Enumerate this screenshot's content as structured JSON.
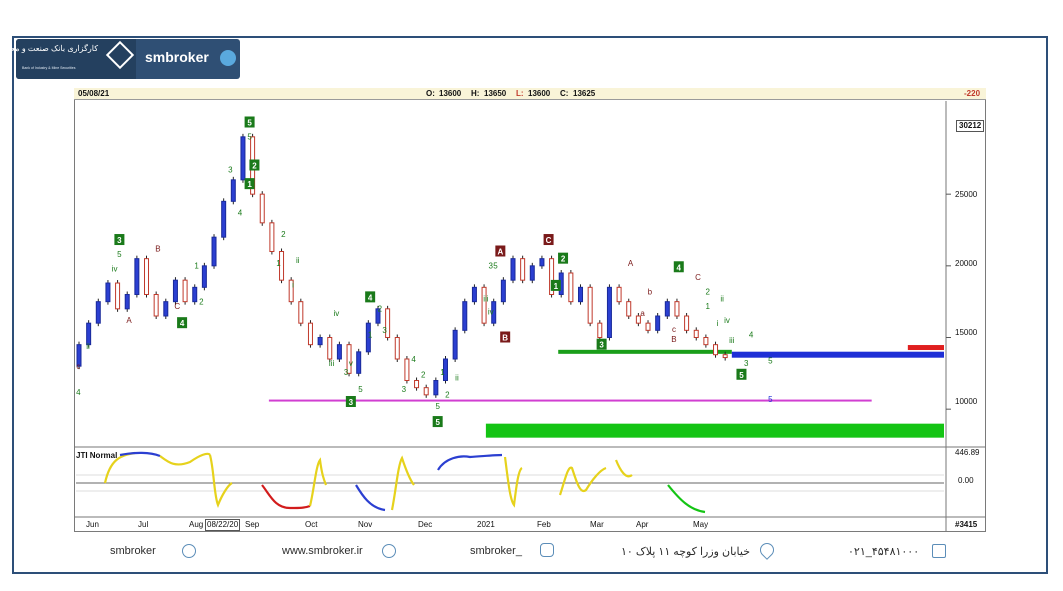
{
  "brand": {
    "logo_text": "کارگزاری بانک صنعت و معدن",
    "logo_subtext": "Bank of Industry & Mine Securities",
    "channel_name": "smbroker",
    "telegram_icon": "telegram-icon"
  },
  "header": {
    "date": "05/08/21",
    "open_label": "O:",
    "open_value": "13600",
    "high_label": "H:",
    "high_value": "13650",
    "low_label": "L:",
    "low_value": "13600",
    "close_label": "C:",
    "close_value": "13625",
    "change_value": "-220",
    "label_color_open": "#111111",
    "label_color_low": "#c0392b",
    "change_color": "#c0392b"
  },
  "chart_data": {
    "type": "line",
    "title": "",
    "price_axis_ticks": [
      "25000",
      "20000",
      "15000",
      "10000"
    ],
    "price_axis_top_label": "30212",
    "ylim": [
      7500,
      31500
    ],
    "month_labels": [
      "Jun",
      "Jul",
      "Aug",
      "Sep",
      "Oct",
      "Nov",
      "Dec",
      "2021",
      "Feb",
      "Mar",
      "Apr",
      "May"
    ],
    "date_cursor_label": "08/22/20",
    "bar_count_label": "#3415",
    "price_path": [
      {
        "x": 0,
        "y": 13000
      },
      {
        "x": 4,
        "y": 14500
      },
      {
        "x": 8,
        "y": 16000
      },
      {
        "x": 12,
        "y": 17500
      },
      {
        "x": 16,
        "y": 18800
      },
      {
        "x": 20,
        "y": 17000
      },
      {
        "x": 24,
        "y": 18000
      },
      {
        "x": 28,
        "y": 20500
      },
      {
        "x": 32,
        "y": 18000
      },
      {
        "x": 36,
        "y": 16500
      },
      {
        "x": 40,
        "y": 17500
      },
      {
        "x": 44,
        "y": 19000
      },
      {
        "x": 48,
        "y": 17500
      },
      {
        "x": 52,
        "y": 18500
      },
      {
        "x": 56,
        "y": 20000
      },
      {
        "x": 60,
        "y": 22000
      },
      {
        "x": 64,
        "y": 24500
      },
      {
        "x": 68,
        "y": 26000
      },
      {
        "x": 72,
        "y": 29000
      },
      {
        "x": 76,
        "y": 25000
      },
      {
        "x": 80,
        "y": 23000
      },
      {
        "x": 84,
        "y": 21000
      },
      {
        "x": 88,
        "y": 19000
      },
      {
        "x": 92,
        "y": 17500
      },
      {
        "x": 96,
        "y": 16000
      },
      {
        "x": 100,
        "y": 14500
      },
      {
        "x": 104,
        "y": 15000
      },
      {
        "x": 108,
        "y": 13500
      },
      {
        "x": 112,
        "y": 14500
      },
      {
        "x": 116,
        "y": 12500
      },
      {
        "x": 120,
        "y": 14000
      },
      {
        "x": 124,
        "y": 16000
      },
      {
        "x": 128,
        "y": 17000
      },
      {
        "x": 132,
        "y": 15000
      },
      {
        "x": 136,
        "y": 13500
      },
      {
        "x": 140,
        "y": 12000
      },
      {
        "x": 144,
        "y": 11500
      },
      {
        "x": 148,
        "y": 11000
      },
      {
        "x": 152,
        "y": 12000
      },
      {
        "x": 156,
        "y": 13500
      },
      {
        "x": 160,
        "y": 15500
      },
      {
        "x": 164,
        "y": 17500
      },
      {
        "x": 168,
        "y": 18500
      },
      {
        "x": 172,
        "y": 16000
      },
      {
        "x": 176,
        "y": 17500
      },
      {
        "x": 180,
        "y": 19000
      },
      {
        "x": 184,
        "y": 20500
      },
      {
        "x": 188,
        "y": 19000
      },
      {
        "x": 192,
        "y": 20000
      },
      {
        "x": 196,
        "y": 20500
      },
      {
        "x": 200,
        "y": 18000
      },
      {
        "x": 204,
        "y": 19500
      },
      {
        "x": 208,
        "y": 17500
      },
      {
        "x": 212,
        "y": 18500
      },
      {
        "x": 216,
        "y": 16000
      },
      {
        "x": 220,
        "y": 15000
      },
      {
        "x": 224,
        "y": 18500
      },
      {
        "x": 228,
        "y": 17500
      },
      {
        "x": 232,
        "y": 16500
      },
      {
        "x": 236,
        "y": 16000
      },
      {
        "x": 240,
        "y": 15500
      },
      {
        "x": 244,
        "y": 16500
      },
      {
        "x": 248,
        "y": 17500
      },
      {
        "x": 252,
        "y": 16500
      },
      {
        "x": 256,
        "y": 15500
      },
      {
        "x": 260,
        "y": 15000
      },
      {
        "x": 264,
        "y": 14500
      },
      {
        "x": 268,
        "y": 13800
      },
      {
        "x": 272,
        "y": 13600
      }
    ],
    "zones": [
      {
        "name": "green-zone",
        "from": 200,
        "to": 272,
        "y": 14000,
        "color": "#1a9e1a"
      },
      {
        "name": "blue-zone",
        "from": 272,
        "to": 360,
        "y": 13800,
        "color": "#1f2fd6"
      },
      {
        "name": "red-zone",
        "from": 345,
        "to": 360,
        "y": 14300,
        "color": "#e01f1f"
      },
      {
        "name": "magenta-line",
        "from": 80,
        "to": 330,
        "y": 10600,
        "color": "#d13fd1"
      },
      {
        "name": "green-band",
        "from": 170,
        "to": 360,
        "y": 8500,
        "color": "#14c414"
      }
    ],
    "wave_labels_boxed": [
      {
        "text": "5",
        "x": 72,
        "y": 30000,
        "color": "#1a7a1a"
      },
      {
        "text": "2",
        "x": 74,
        "y": 27000,
        "color": "#1a7a1a"
      },
      {
        "text": "1",
        "x": 72,
        "y": 25700,
        "color": "#1a7a1a"
      },
      {
        "text": "3",
        "x": 18,
        "y": 21800,
        "color": "#1a7a1a"
      },
      {
        "text": "4",
        "x": 44,
        "y": 16000,
        "color": "#1a7a1a"
      },
      {
        "text": "4",
        "x": 122,
        "y": 17800,
        "color": "#1a7a1a"
      },
      {
        "text": "3",
        "x": 114,
        "y": 10500,
        "color": "#1a7a1a"
      },
      {
        "text": "5",
        "x": 150,
        "y": 9100,
        "color": "#1a7a1a"
      },
      {
        "text": "A",
        "x": 176,
        "y": 21000,
        "color": "#7a1a1a"
      },
      {
        "text": "B",
        "x": 178,
        "y": 15000,
        "color": "#7a1a1a"
      },
      {
        "text": "C",
        "x": 196,
        "y": 21800,
        "color": "#7a1a1a"
      },
      {
        "text": "2",
        "x": 202,
        "y": 20500,
        "color": "#1a7a1a"
      },
      {
        "text": "1",
        "x": 199,
        "y": 18600,
        "color": "#1a7a1a"
      },
      {
        "text": "3",
        "x": 218,
        "y": 14500,
        "color": "#1a7a1a"
      },
      {
        "text": "4",
        "x": 250,
        "y": 19900,
        "color": "#1a7a1a"
      },
      {
        "text": "5",
        "x": 276,
        "y": 12400,
        "color": "#1a7a1a"
      }
    ],
    "wave_labels_plain": [
      {
        "text": "5",
        "x": 72,
        "y": 28800,
        "color": "#1a7a1a"
      },
      {
        "text": "3",
        "x": 64,
        "y": 26500,
        "color": "#1a7a1a"
      },
      {
        "text": "4",
        "x": 68,
        "y": 23500,
        "color": "#1a7a1a"
      },
      {
        "text": "5",
        "x": 18,
        "y": 20600,
        "color": "#1a7a1a"
      },
      {
        "text": "B",
        "x": 34,
        "y": 21000,
        "color": "#7a1a1a"
      },
      {
        "text": "iv",
        "x": 16,
        "y": 19600,
        "color": "#1a7a1a"
      },
      {
        "text": "A",
        "x": 22,
        "y": 16000,
        "color": "#7a1a1a"
      },
      {
        "text": "C",
        "x": 42,
        "y": 17000,
        "color": "#7a1a1a"
      },
      {
        "text": "2",
        "x": 52,
        "y": 17300,
        "color": "#1a7a1a"
      },
      {
        "text": "1",
        "x": 50,
        "y": 19800,
        "color": "#1a7a1a"
      },
      {
        "text": "4",
        "x": 1,
        "y": 11000,
        "color": "#1a7a1a"
      },
      {
        "text": "c",
        "x": 1,
        "y": 12800,
        "color": "#7a1a1a"
      },
      {
        "text": "ii",
        "x": 5,
        "y": 14200,
        "color": "#1a7a1a"
      },
      {
        "text": "ii",
        "x": 92,
        "y": 20200,
        "color": "#1a7a1a"
      },
      {
        "text": "2",
        "x": 86,
        "y": 22000,
        "color": "#1a7a1a"
      },
      {
        "text": "1",
        "x": 84,
        "y": 20000,
        "color": "#1a7a1a"
      },
      {
        "text": "i",
        "x": 90,
        "y": 18500,
        "color": "#1a7a1a"
      },
      {
        "text": "iv",
        "x": 108,
        "y": 16500,
        "color": "#1a7a1a"
      },
      {
        "text": "iii",
        "x": 106,
        "y": 13000,
        "color": "#1a7a1a"
      },
      {
        "text": "v",
        "x": 114,
        "y": 13000,
        "color": "#1a7a1a"
      },
      {
        "text": "3",
        "x": 112,
        "y": 12400,
        "color": "#1a7a1a"
      },
      {
        "text": "5",
        "x": 118,
        "y": 11200,
        "color": "#1a7a1a"
      },
      {
        "text": "2",
        "x": 126,
        "y": 16800,
        "color": "#1a7a1a"
      },
      {
        "text": "1",
        "x": 122,
        "y": 15000,
        "color": "#1a7a1a"
      },
      {
        "text": "3",
        "x": 128,
        "y": 15300,
        "color": "#1a7a1a"
      },
      {
        "text": "4",
        "x": 140,
        "y": 13300,
        "color": "#1a7a1a"
      },
      {
        "text": "3",
        "x": 136,
        "y": 11200,
        "color": "#1a7a1a"
      },
      {
        "text": "2",
        "x": 144,
        "y": 12200,
        "color": "#1a7a1a"
      },
      {
        "text": "1",
        "x": 152,
        "y": 12400,
        "color": "#1a7a1a"
      },
      {
        "text": "5",
        "x": 150,
        "y": 10000,
        "color": "#1a7a1a"
      },
      {
        "text": "2",
        "x": 154,
        "y": 10800,
        "color": "#1a7a1a"
      },
      {
        "text": "ii",
        "x": 158,
        "y": 12000,
        "color": "#1a7a1a"
      },
      {
        "text": "3",
        "x": 172,
        "y": 19800,
        "color": "#1a7a1a"
      },
      {
        "text": "5",
        "x": 174,
        "y": 19800,
        "color": "#1a7a1a"
      },
      {
        "text": "iii",
        "x": 170,
        "y": 17500,
        "color": "#1a7a1a"
      },
      {
        "text": "iv",
        "x": 172,
        "y": 16600,
        "color": "#1a7a1a"
      },
      {
        "text": "A",
        "x": 230,
        "y": 20000,
        "color": "#7a1a1a"
      },
      {
        "text": "b",
        "x": 238,
        "y": 18000,
        "color": "#7a1a1a"
      },
      {
        "text": "a",
        "x": 235,
        "y": 16500,
        "color": "#7a1a1a"
      },
      {
        "text": "c",
        "x": 248,
        "y": 15400,
        "color": "#7a1a1a"
      },
      {
        "text": "B",
        "x": 248,
        "y": 14700,
        "color": "#7a1a1a"
      },
      {
        "text": "C",
        "x": 258,
        "y": 19000,
        "color": "#7a1a1a"
      },
      {
        "text": "2",
        "x": 262,
        "y": 18000,
        "color": "#1a7a1a"
      },
      {
        "text": "1",
        "x": 262,
        "y": 17000,
        "color": "#1a7a1a"
      },
      {
        "text": "ii",
        "x": 268,
        "y": 17500,
        "color": "#1a7a1a"
      },
      {
        "text": "i",
        "x": 266,
        "y": 15800,
        "color": "#1a7a1a"
      },
      {
        "text": "iv",
        "x": 270,
        "y": 16000,
        "color": "#1a7a1a"
      },
      {
        "text": "iii",
        "x": 272,
        "y": 14600,
        "color": "#1a7a1a"
      },
      {
        "text": "4",
        "x": 280,
        "y": 15000,
        "color": "#1a7a1a"
      },
      {
        "text": "3",
        "x": 278,
        "y": 13000,
        "color": "#1a7a1a"
      },
      {
        "text": "5",
        "x": 288,
        "y": 13200,
        "color": "#1a7a1a"
      },
      {
        "text": "5",
        "x": 288,
        "y": 10500,
        "color": "#1f2fd6"
      }
    ]
  },
  "indicator": {
    "name": "JTI Normal",
    "top_value": "446.89",
    "zero_value": "0.00"
  },
  "footer": {
    "telegram": "smbroker",
    "website": "www.smbroker.ir",
    "instagram": "smbroker_",
    "address": "خیابان وزرا کوچه ۱۱ پلاک ۱۰",
    "phone": "۰۲۱_۴۵۴۸۱۰۰۰"
  }
}
